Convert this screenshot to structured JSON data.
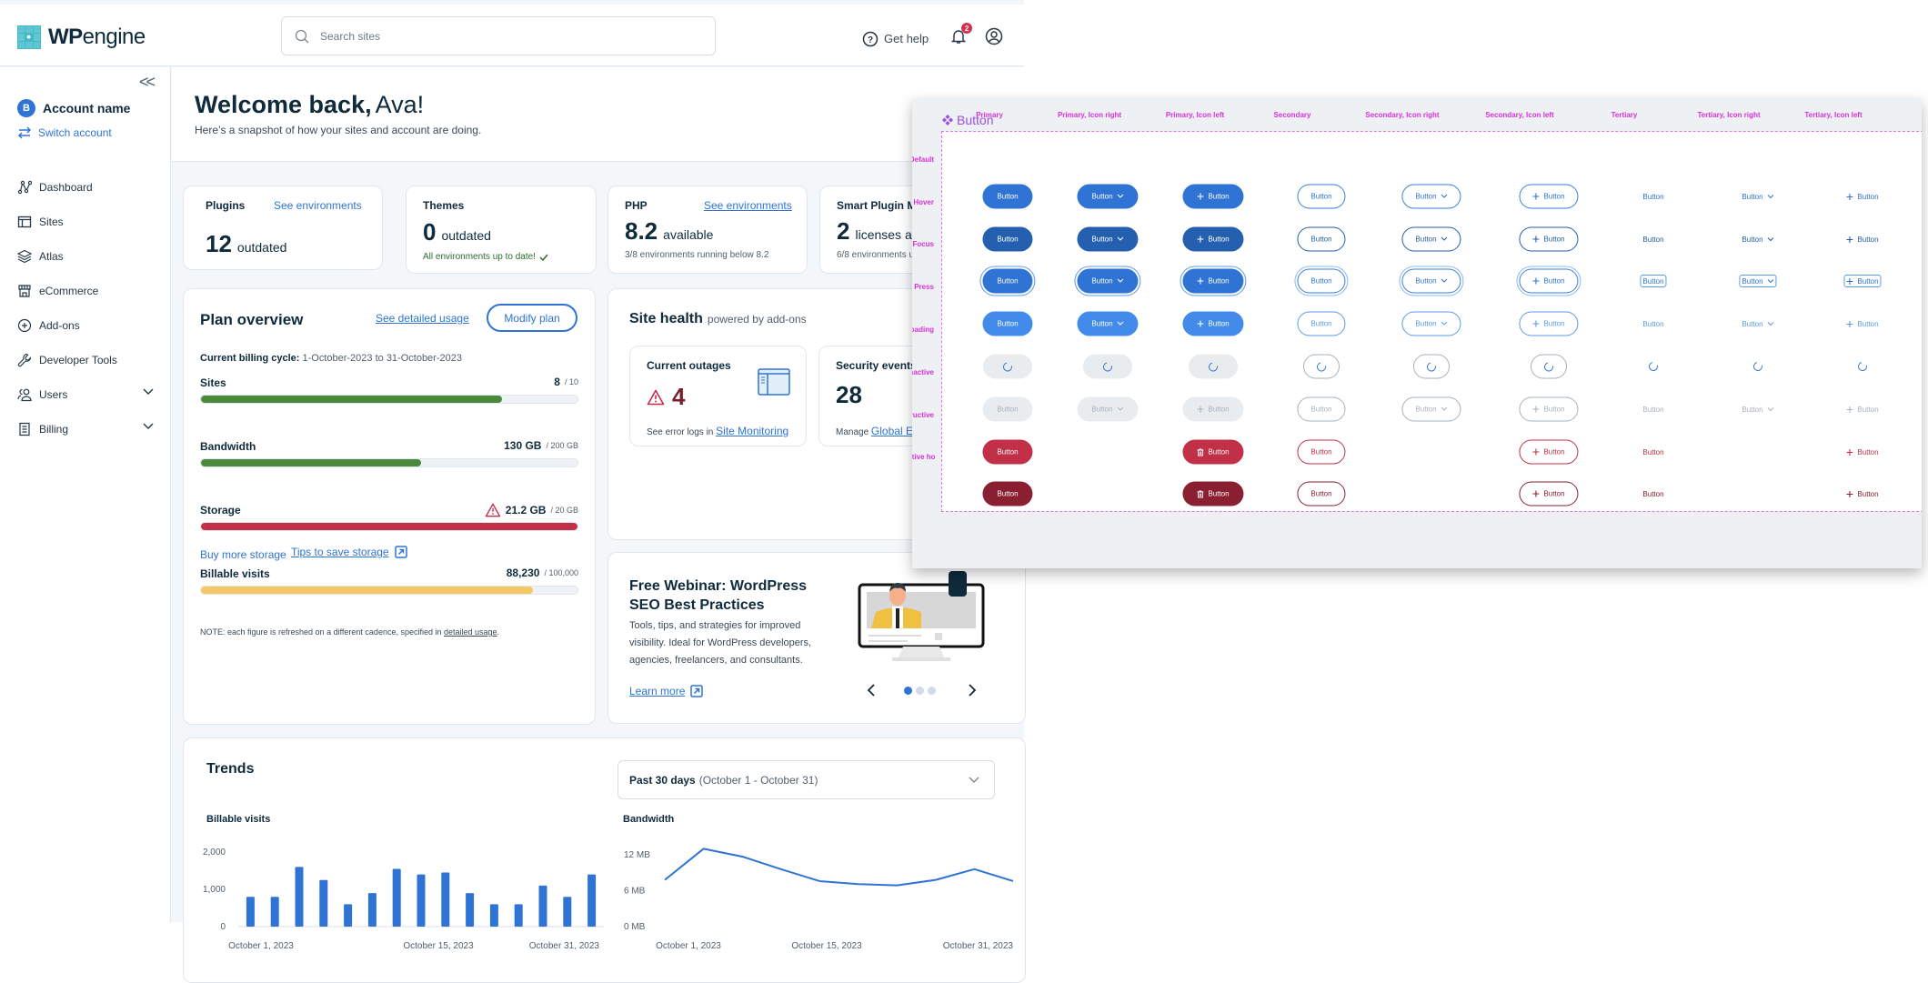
{
  "header": {
    "logo_bold": "WP",
    "logo_light": "engine",
    "search_placeholder": "Search sites",
    "help_label": "Get help",
    "notification_count": "2"
  },
  "sidebar": {
    "collapse_label": "<<",
    "account_initial": "B",
    "account_name": "Account name",
    "switch_label": "Switch account",
    "items": [
      {
        "label": "Dashboard",
        "icon": "dashboard-icon"
      },
      {
        "label": "Sites",
        "icon": "sites-icon"
      },
      {
        "label": "Atlas",
        "icon": "atlas-layers-icon"
      },
      {
        "label": "eCommerce",
        "icon": "storefront-icon"
      },
      {
        "label": "Add-ons",
        "icon": "plus-circle-icon"
      },
      {
        "label": "Developer Tools",
        "icon": "wrench-icon"
      },
      {
        "label": "Users",
        "icon": "users-icon",
        "expandable": true
      },
      {
        "label": "Billing",
        "icon": "billing-icon",
        "expandable": true
      }
    ]
  },
  "welcome": {
    "title_bold": "Welcome back,",
    "title_name": "Ava!",
    "subtitle": "Here’s a snapshot of how your sites and account are doing."
  },
  "stats": {
    "plugins": {
      "title": "Plugins",
      "link": "See environments",
      "value": "12",
      "unit": "outdated"
    },
    "themes": {
      "title": "Themes",
      "value": "0",
      "unit": "outdated",
      "note": "All environments up to date!"
    },
    "php": {
      "title": "PHP",
      "link": "See environments",
      "value": "8.2",
      "unit": "available",
      "note": "3/8 environments running below 8.2"
    },
    "smart_plugin": {
      "title": "Smart Plugin M",
      "value": "2",
      "unit": "licenses ava",
      "note": "6/8 environments u"
    }
  },
  "plan": {
    "title": "Plan overview",
    "detail_link": "See detailed usage",
    "modify_button": "Modify plan",
    "billing_label": "Current billing cycle:",
    "billing_range": "1-October-2023 to 31-October-2023",
    "rows": [
      {
        "label": "Sites",
        "value": "8",
        "max": "/ 10",
        "fraction": 0.8,
        "color": "#4a8a3b"
      },
      {
        "label": "Bandwidth",
        "value": "130 GB",
        "max": "/ 200 GB",
        "fraction": 0.585,
        "color": "#4a8a3b"
      },
      {
        "label": "Storage",
        "value": "21.2 GB",
        "max": "/ 20 GB",
        "fraction": 1.0,
        "color": "#c23047",
        "warning": true
      },
      {
        "label": "Billable visits",
        "value": "88,230",
        "max": "/ 100,000",
        "fraction": 0.8823,
        "color": "#f5c865"
      }
    ],
    "buy_storage": "Buy more storage",
    "tips_storage": "Tips to save storage",
    "note_prefix": "NOTE: each figure is refreshed on a different cadence, specified in ",
    "note_link": "detailed usage",
    "note_suffix": "."
  },
  "site_health": {
    "title": "Site health",
    "subtitle": "powered by add-ons",
    "outages": {
      "title": "Current outages",
      "value": "4",
      "note_prefix": "See error logs in ",
      "note_link": "Site Monitoring"
    },
    "security": {
      "title": "Security events",
      "value": "28",
      "note_prefix": "Manage ",
      "note_link": "Global Ed"
    }
  },
  "webinar": {
    "title": "Free Webinar: WordPress SEO Best Practices",
    "body": "Tools, tips, and strategies for improved visibility. Ideal for WordPress developers, agencies, freelancers, and consultants.",
    "link": "Learn more",
    "carousel_pages": 3,
    "carousel_active": 1
  },
  "trends": {
    "title": "Trends",
    "range_bold": "Past 30 days",
    "range_detail": "(October 1 - October 31)"
  },
  "chart_data": [
    {
      "type": "bar",
      "title": "Billable visits",
      "xlabel": "",
      "ylabel": "",
      "ylim": [
        0,
        2000
      ],
      "yticks": [
        {
          "v": 0,
          "label": "0"
        },
        {
          "v": 1000,
          "label": "1,000"
        },
        {
          "v": 2000,
          "label": "2,000"
        }
      ],
      "xtick_labels": [
        "October 1, 2023",
        "October 15, 2023",
        "October 31, 2023"
      ],
      "values": [
        800,
        800,
        1600,
        1250,
        600,
        900,
        1550,
        1400,
        1450,
        900,
        600,
        600,
        1100,
        800,
        1400
      ],
      "color": "#2f73d4"
    },
    {
      "type": "line",
      "title": "Bandwidth",
      "xlabel": "",
      "ylabel": "",
      "ylim": [
        0,
        12
      ],
      "unit": "MB",
      "yticks": [
        {
          "v": 0,
          "label": "0 MB"
        },
        {
          "v": 6,
          "label": "6 MB"
        },
        {
          "v": 12,
          "label": "12 MB"
        }
      ],
      "xtick_labels": [
        "October 1, 2023",
        "October 15, 2023",
        "October 31, 2023"
      ],
      "values": [
        7.8,
        13.0,
        11.7,
        9.6,
        7.6,
        7.1,
        6.9,
        7.8,
        9.6,
        7.6
      ],
      "color": "#2f73d4"
    }
  ],
  "design_sheet": {
    "title": "Button",
    "button_label": "Button",
    "columns": [
      "Primary",
      "Primary, Icon right",
      "Primary, Icon left",
      "Secondary",
      "Secondary, Icon right",
      "Secondary, Icon left",
      "Tertiary",
      "Tertiary, Icon right",
      "Tertiary, Icon left"
    ],
    "rows": [
      "Default",
      "Hover",
      "Focus",
      "Press",
      "Loading",
      "Inactive",
      "Destructive",
      "Destructive hover"
    ]
  }
}
